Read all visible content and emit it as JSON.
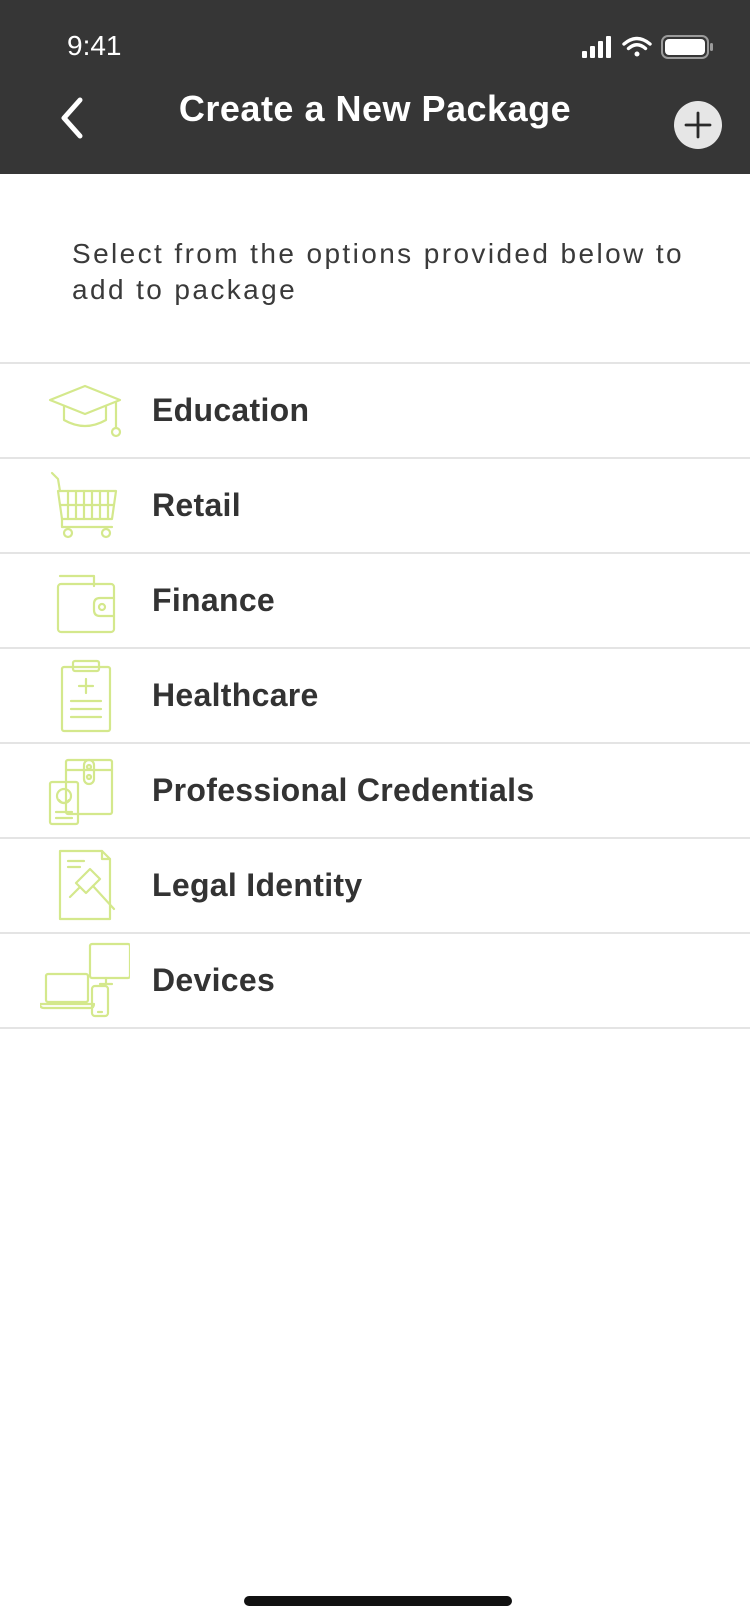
{
  "status_bar": {
    "time": "9:41"
  },
  "header": {
    "title": "Create a New Package",
    "back_icon": "chevron-left-icon",
    "add_icon": "plus-icon"
  },
  "intro": {
    "text": "Select from the options provided below to add to package"
  },
  "categories": [
    {
      "label": "Education",
      "icon": "graduation-cap-icon"
    },
    {
      "label": "Retail",
      "icon": "shopping-cart-icon"
    },
    {
      "label": "Finance",
      "icon": "wallet-icon"
    },
    {
      "label": "Healthcare",
      "icon": "clipboard-medical-icon"
    },
    {
      "label": "Professional Credentials",
      "icon": "credential-folder-icon"
    },
    {
      "label": "Legal Identity",
      "icon": "gavel-document-icon"
    },
    {
      "label": "Devices",
      "icon": "devices-icon"
    }
  ],
  "colors": {
    "header_bg": "#363636",
    "icon_accent": "#d4e88c",
    "text": "#333333",
    "divider": "#e4e4e4"
  }
}
